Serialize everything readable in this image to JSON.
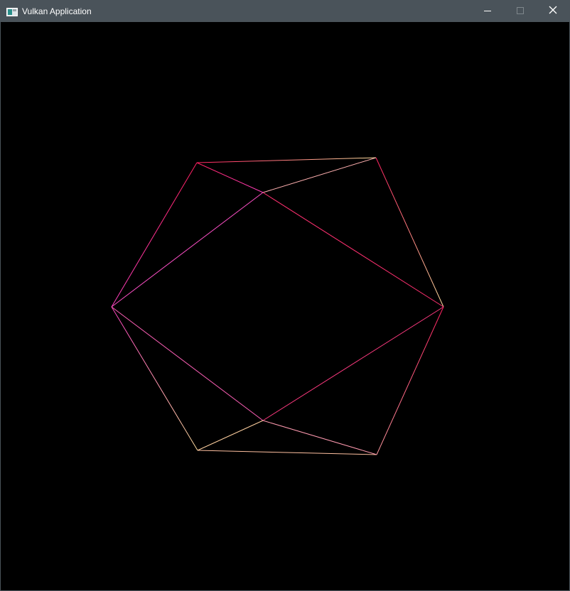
{
  "window": {
    "title": "Vulkan Application",
    "icon": "vulkan-app-icon",
    "controls": [
      "minimize-icon",
      "maximize-icon",
      "close-icon"
    ]
  },
  "scene": {
    "shape": "icosahedron-wireframe",
    "colors": {
      "pink": "#ff40c0",
      "red": "#ff2060",
      "orange": "#ff9aa0",
      "yellow": "#ffe0a0"
    }
  }
}
